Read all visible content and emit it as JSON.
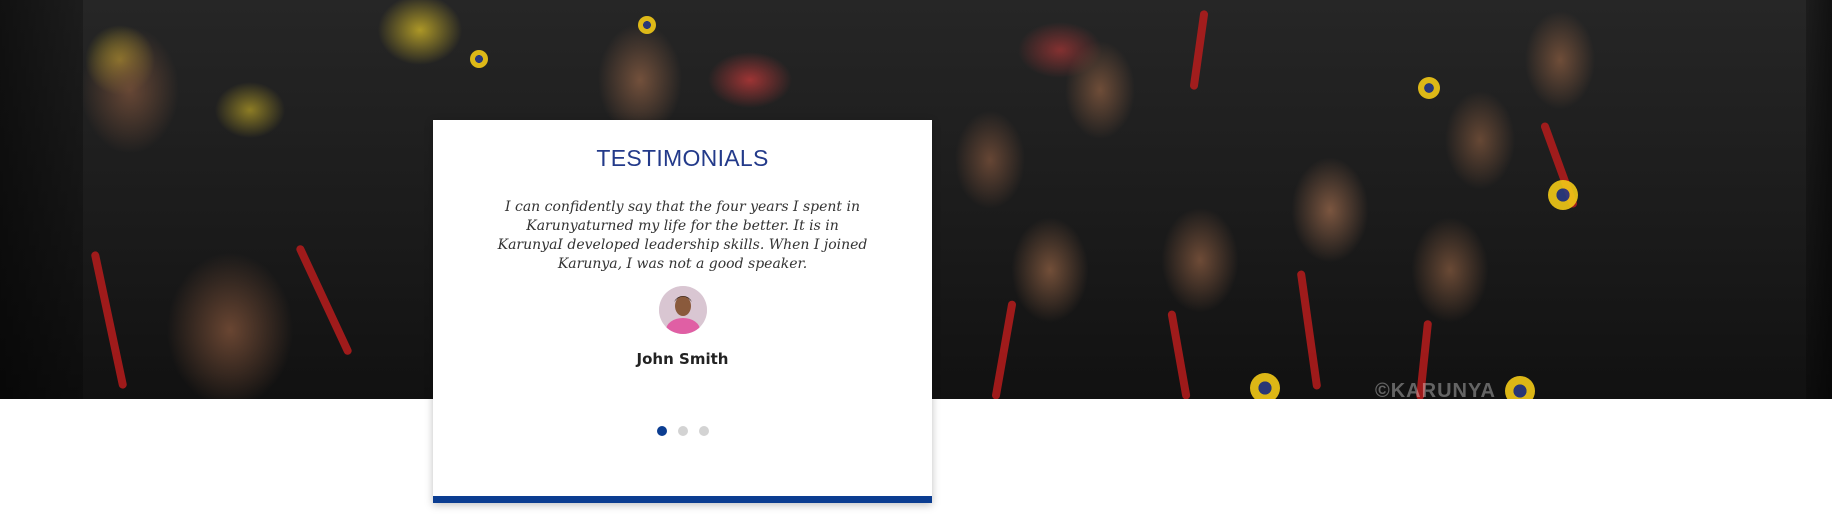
{
  "hero": {
    "watermark": "©KARUNYA"
  },
  "testimonials": {
    "title": "TESTIMONIALS",
    "quote": "I can confidently say that the four years I spent in Karunyaturned my life for the better. It is in KarunyaI developed leadership skills. When I joined Karunya, I was not a good speaker.",
    "author": "John Smith",
    "dots": 3,
    "active_dot": 1
  },
  "colors": {
    "accent": "#0b3d91",
    "title": "#233a8a",
    "dot_inactive": "#d3d3d3"
  }
}
